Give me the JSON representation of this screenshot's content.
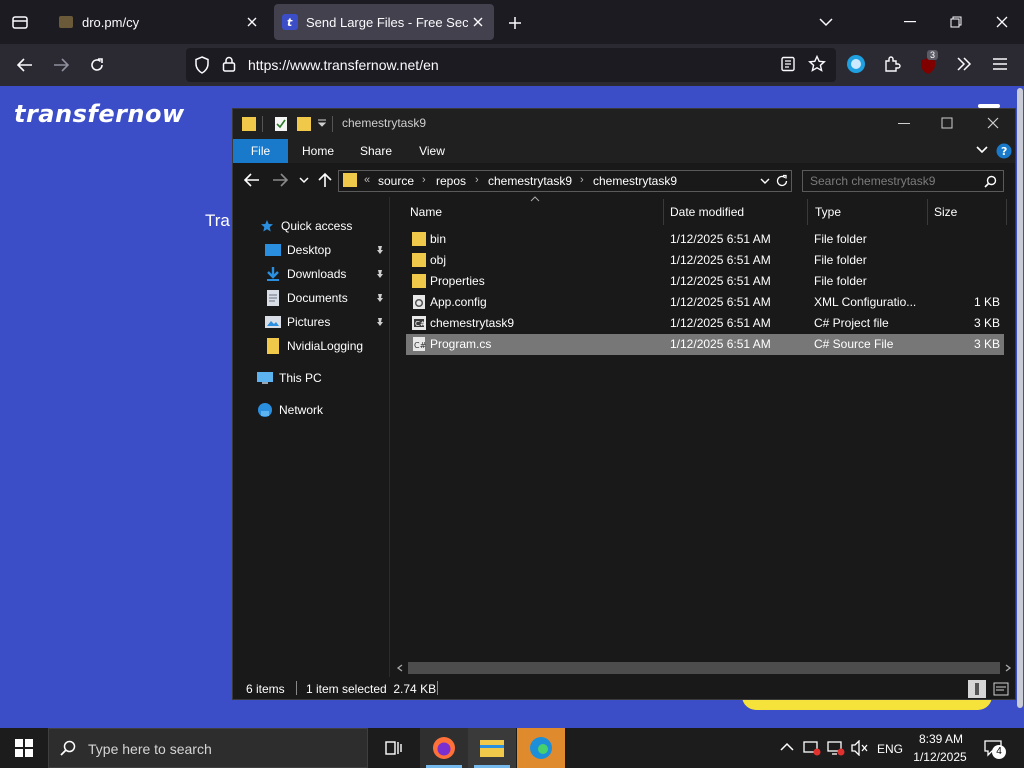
{
  "browser": {
    "tabs": [
      {
        "title": "dro.pm/cy",
        "active": false
      },
      {
        "title": "Send Large Files - Free Secure File Transfer",
        "active": true
      }
    ],
    "url": "https://www.transfernow.net/en",
    "extension_badge": "3"
  },
  "page": {
    "brand": "transfernow",
    "fragment_text": "Tra"
  },
  "explorer": {
    "title": "chemestrytask9",
    "ribbon_tabs": [
      "File",
      "Home",
      "Share",
      "View"
    ],
    "breadcrumb": [
      "source",
      "repos",
      "chemestrytask9",
      "chemestrytask9"
    ],
    "search_placeholder": "Search chemestrytask9",
    "nav": {
      "quick_access": "Quick access",
      "items": [
        "Desktop",
        "Downloads",
        "Documents",
        "Pictures",
        "NvidiaLogging"
      ],
      "this_pc": "This PC",
      "network": "Network"
    },
    "columns": {
      "name": "Name",
      "date": "Date modified",
      "type": "Type",
      "size": "Size"
    },
    "files": [
      {
        "name": "bin",
        "date": "1/12/2025 6:51 AM",
        "type": "File folder",
        "size": "",
        "icon": "folder-icon",
        "selected": false
      },
      {
        "name": "obj",
        "date": "1/12/2025 6:51 AM",
        "type": "File folder",
        "size": "",
        "icon": "folder-icon",
        "selected": false
      },
      {
        "name": "Properties",
        "date": "1/12/2025 6:51 AM",
        "type": "File folder",
        "size": "",
        "icon": "folder-icon",
        "selected": false
      },
      {
        "name": "App.config",
        "date": "1/12/2025 6:51 AM",
        "type": "XML Configuratio...",
        "size": "1 KB",
        "icon": "config-file-icon",
        "selected": false
      },
      {
        "name": "chemestrytask9",
        "date": "1/12/2025 6:51 AM",
        "type": "C# Project file",
        "size": "3 KB",
        "icon": "csproj-file-icon",
        "selected": false
      },
      {
        "name": "Program.cs",
        "date": "1/12/2025 6:51 AM",
        "type": "C# Source File",
        "size": "3 KB",
        "icon": "cs-file-icon",
        "selected": true
      }
    ],
    "status": {
      "count": "6 items",
      "selection": "1 item selected  2.74 KB"
    }
  },
  "taskbar": {
    "search_placeholder": "Type here to search",
    "language": "ENG",
    "time": "8:39 AM",
    "date": "1/12/2025",
    "notifications": "4"
  },
  "colors": {
    "page_blue": "#3c4ec7",
    "ribbon_file": "#1979ca",
    "selected_row": "#777777",
    "folder": "#f0c94a"
  }
}
